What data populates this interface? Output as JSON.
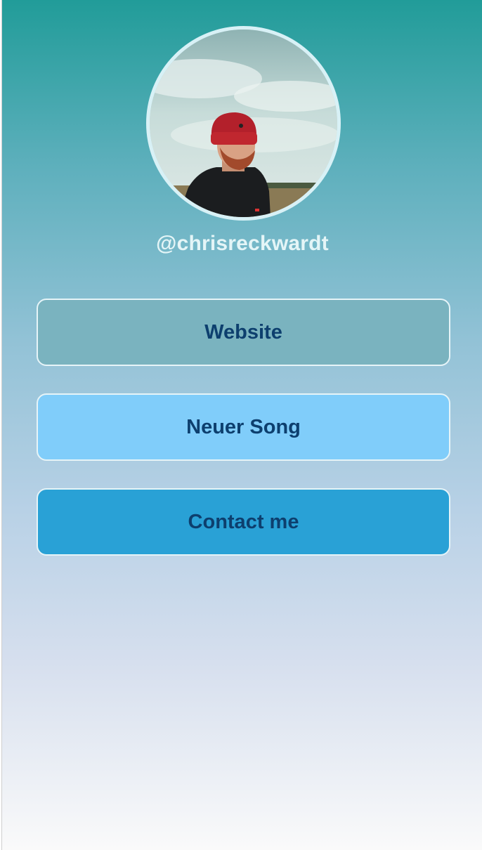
{
  "profile": {
    "handle": "@chrisreckwardt",
    "avatar_alt": "profile-photo"
  },
  "links": [
    {
      "label": "Website",
      "color": "#7ab3bf"
    },
    {
      "label": "Neuer Song",
      "color": "#80cdfa"
    },
    {
      "label": "Contact me",
      "color": "#29a1d6"
    }
  ],
  "colors": {
    "gradient_top": "#219c99",
    "gradient_bottom": "#fafafa",
    "button_text": "#0d3f6e",
    "handle_text": "#e4f5f7"
  }
}
